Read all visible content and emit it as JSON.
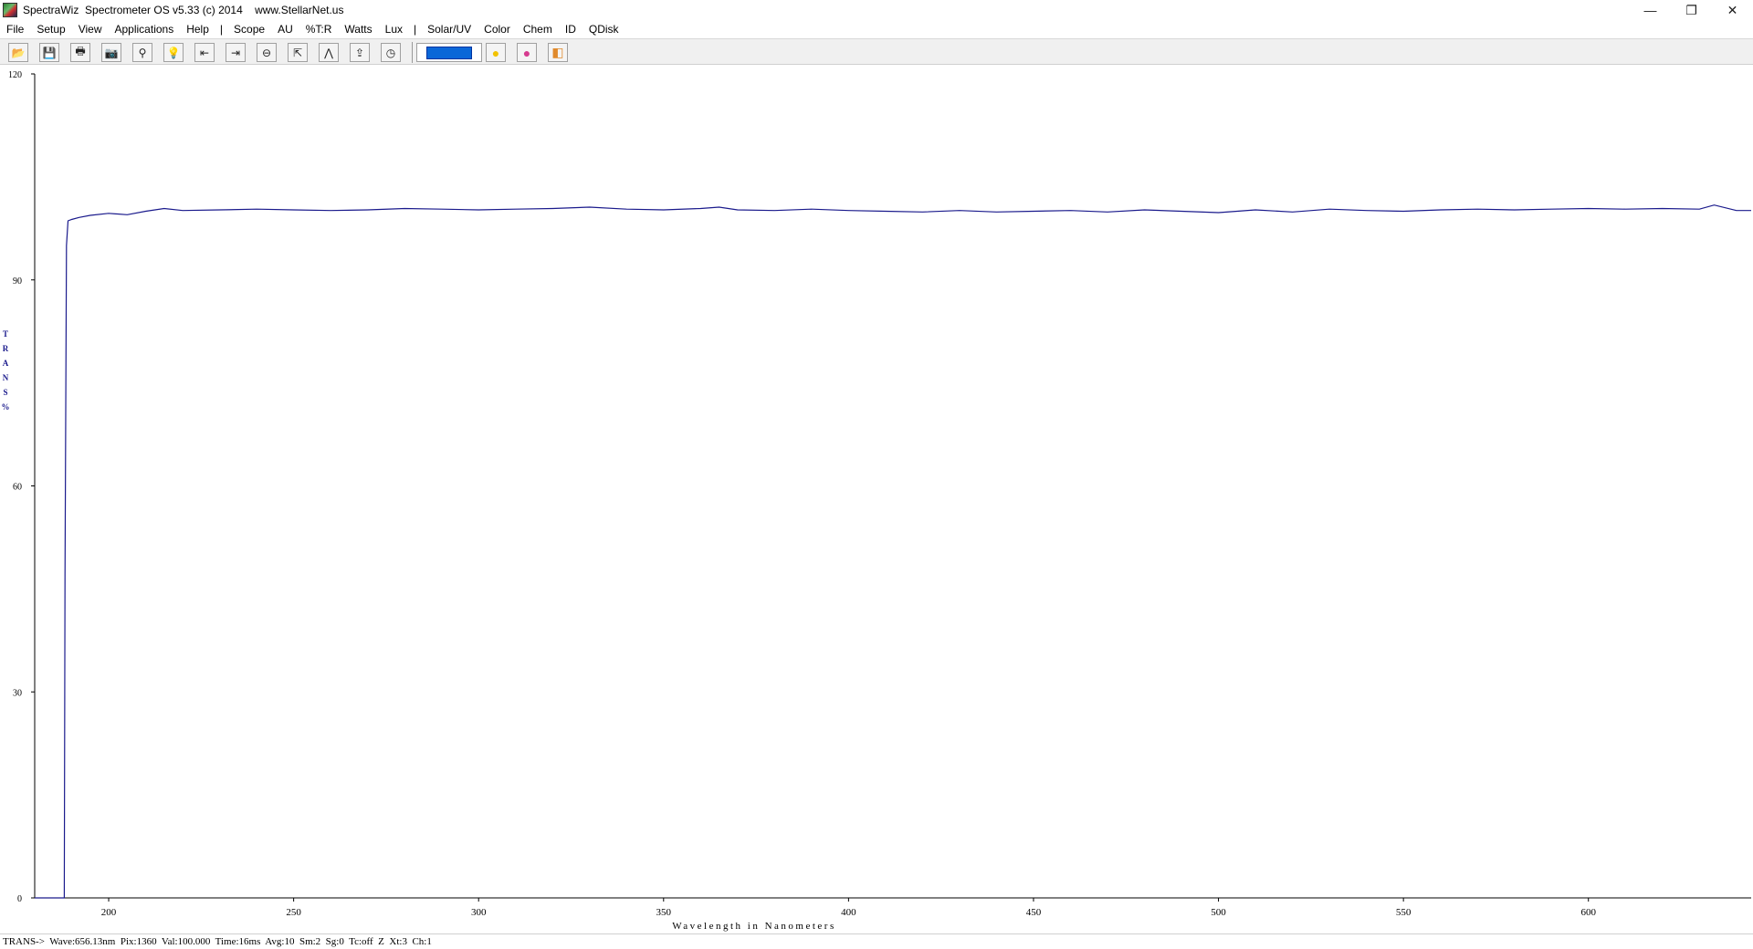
{
  "window": {
    "title": "SpectraWiz  Spectrometer OS v5.33 (c) 2014    www.StellarNet.us",
    "minimize": "—",
    "restore": "❐",
    "close": "✕"
  },
  "menu": [
    "File",
    "Setup",
    "View",
    "Applications",
    "Help",
    "|",
    "Scope",
    "AU",
    "%T:R",
    "Watts",
    "Lux",
    "|",
    "Solar/UV",
    "Color",
    "Chem",
    "ID",
    "QDisk"
  ],
  "toolbar": {
    "buttons": [
      {
        "name": "open-icon",
        "glyph": "📂"
      },
      {
        "name": "save-icon",
        "glyph": "💾"
      },
      {
        "name": "print-icon",
        "glyph": "🖶"
      },
      {
        "name": "camera-icon",
        "glyph": "📷"
      },
      {
        "name": "probe-icon",
        "glyph": "⚲"
      },
      {
        "name": "lamp-icon",
        "glyph": "💡"
      },
      {
        "name": "scroll-left-icon",
        "glyph": "⇤"
      },
      {
        "name": "scroll-right-icon",
        "glyph": "⇥"
      },
      {
        "name": "zoom-out-icon",
        "glyph": "⊖"
      },
      {
        "name": "autoscale-icon",
        "glyph": "⇱"
      },
      {
        "name": "peak-icon",
        "glyph": "⋀"
      },
      {
        "name": "export-icon",
        "glyph": "⇪"
      },
      {
        "name": "timer-icon",
        "glyph": "◷"
      }
    ],
    "extra_buttons": [
      {
        "name": "circle-icon",
        "glyph": "●",
        "color": "#f2c200"
      },
      {
        "name": "color-wheel-icon",
        "glyph": "●",
        "color": "#d63b8f"
      },
      {
        "name": "palette-icon",
        "glyph": "◧",
        "color": "#e08a2c"
      }
    ],
    "color_swatch": "#0a67d8"
  },
  "chart_data": {
    "type": "line",
    "xlabel": "Wavelength in Nanometers",
    "ylabel_letters": [
      "T",
      "R",
      "A",
      "N",
      "S",
      "%"
    ],
    "xlim": [
      180,
      644
    ],
    "ylim": [
      0,
      120
    ],
    "x_ticks": [
      200,
      250,
      300,
      350,
      400,
      450,
      500,
      550,
      600
    ],
    "y_ticks": [
      0,
      30,
      60,
      90,
      120
    ],
    "grid": false,
    "line_color": "#1a1a8c",
    "series": [
      {
        "x": [
          180,
          188,
          188.2,
          188.6,
          189,
          190,
          192,
          195,
          200,
          205,
          210,
          215,
          220,
          230,
          240,
          250,
          260,
          270,
          280,
          290,
          300,
          310,
          320,
          330,
          340,
          350,
          360,
          365,
          370,
          380,
          390,
          400,
          410,
          420,
          430,
          440,
          450,
          460,
          470,
          480,
          490,
          500,
          510,
          520,
          530,
          540,
          550,
          560,
          570,
          580,
          590,
          600,
          610,
          620,
          630,
          634,
          640,
          644
        ],
        "y": [
          0,
          0,
          47,
          95,
          98.6,
          98.8,
          99.1,
          99.4,
          99.7,
          99.5,
          100.0,
          100.4,
          100.1,
          100.2,
          100.3,
          100.2,
          100.1,
          100.2,
          100.4,
          100.3,
          100.2,
          100.3,
          100.4,
          100.6,
          100.3,
          100.2,
          100.4,
          100.6,
          100.2,
          100.1,
          100.3,
          100.1,
          100.0,
          99.9,
          100.1,
          99.9,
          100.0,
          100.1,
          99.9,
          100.2,
          100.0,
          99.8,
          100.2,
          99.9,
          100.3,
          100.1,
          100.0,
          100.2,
          100.3,
          100.2,
          100.3,
          100.4,
          100.3,
          100.4,
          100.3,
          100.9,
          100.1,
          100.1
        ]
      }
    ]
  },
  "status": {
    "text": "TRANS->  Wave:656.13nm  Pix:1360  Val:100.000  Time:16ms  Avg:10  Sm:2  Sg:0  Tc:off  Z  Xt:3  Ch:1"
  }
}
